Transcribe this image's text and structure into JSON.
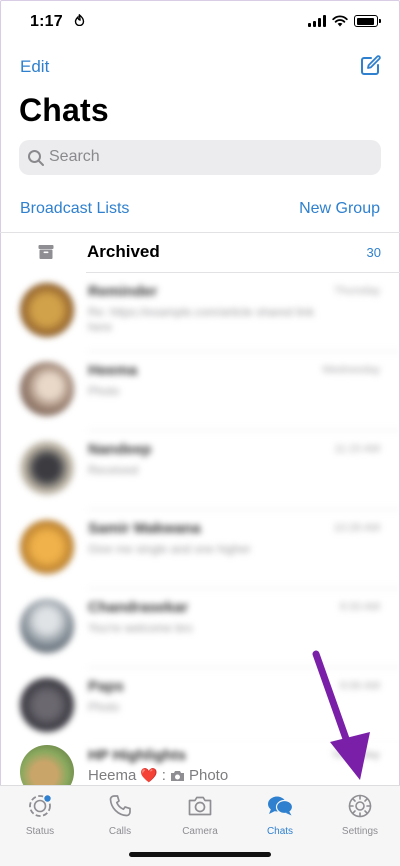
{
  "status_bar": {
    "time": "1:17"
  },
  "header": {
    "edit_label": "Edit",
    "title": "Chats",
    "search_placeholder": "Search",
    "broadcast_label": "Broadcast Lists",
    "new_group_label": "New Group"
  },
  "archived": {
    "label": "Archived",
    "count": "30"
  },
  "chats": [
    {
      "name": "Reminder",
      "message": "Re: https://example.com/article shared link here",
      "time": "Thursday"
    },
    {
      "name": "Heema",
      "message": "Photo",
      "time": "Wednesday"
    },
    {
      "name": "Nandeep",
      "message": "Received",
      "time": "11:15 AM"
    },
    {
      "name": "Samir Makwana",
      "message": "Give me single and one higher",
      "time": "10:28 AM"
    },
    {
      "name": "Chandrasekar",
      "message": "You're welcome bro",
      "time": "9:33 AM"
    },
    {
      "name": "Paps",
      "message": "Photo",
      "time": "9:06 AM"
    }
  ],
  "last_row": {
    "name": "HP Highlights",
    "sender": "Heema",
    "heart": "❤️",
    "message": "Photo",
    "time": "Yesterday"
  },
  "tabs": [
    {
      "label": "Status"
    },
    {
      "label": "Calls"
    },
    {
      "label": "Camera"
    },
    {
      "label": "Chats"
    },
    {
      "label": "Settings"
    }
  ],
  "colors": {
    "accent": "#2f80ce",
    "arrow": "#7a1fa8",
    "inactive": "#8e8e93"
  }
}
